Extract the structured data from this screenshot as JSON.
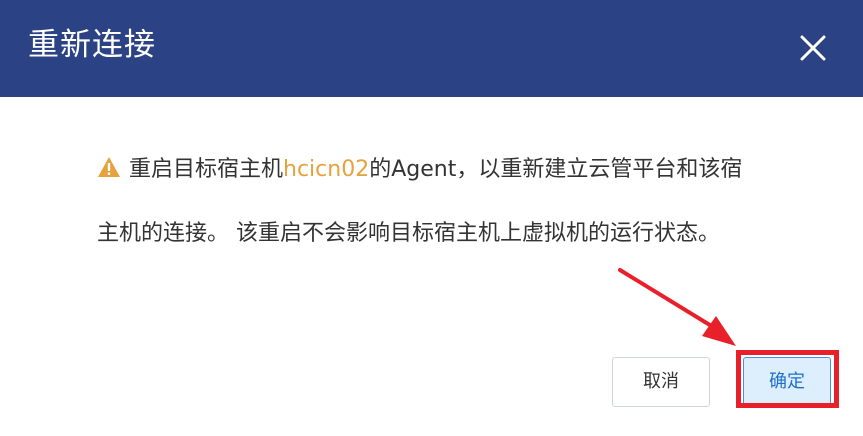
{
  "dialog": {
    "title": "重新连接",
    "close_icon": "close-icon",
    "message": {
      "warning_icon": "warning-icon",
      "part1": "重启目标宿主机",
      "host": "hcicn02",
      "part2": "的Agent，以重新建立云管平台和该宿主机的连接。 该重启不会影响目标宿主机上虚拟机的运行状态。"
    },
    "buttons": {
      "cancel_label": "取消",
      "confirm_label": "确定"
    }
  },
  "colors": {
    "header_bg": "#2b4384",
    "host_highlight": "#e6a23c",
    "warning": "#e6a23c",
    "annotation": "#e8202a",
    "confirm_text": "#1f6fcf"
  }
}
